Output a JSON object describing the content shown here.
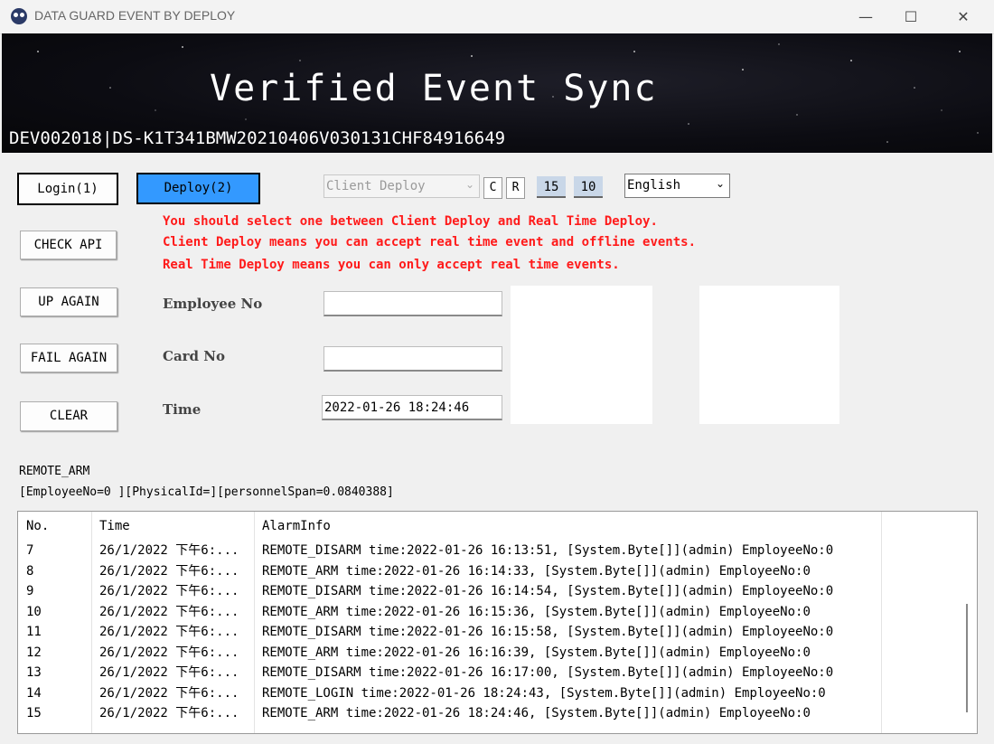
{
  "window": {
    "title": "DATA GUARD EVENT BY DEPLOY",
    "minimize": "—",
    "maximize": "☐",
    "close": "✕"
  },
  "banner": {
    "title": "Verified Event Sync",
    "device": "DEV002018|DS-K1T341BMW20210406V030131CHF84916649"
  },
  "buttons": {
    "login": "Login(1)",
    "deploy": "Deploy(2)",
    "check_api": "CHECK API",
    "up_again": "UP AGAIN",
    "fail_again": "FAIL AGAIN",
    "clear": "CLEAR"
  },
  "deploy_mode": {
    "selected": "Client Deploy"
  },
  "small_buttons": {
    "c": "C",
    "r": "R"
  },
  "numbers": {
    "first": "15",
    "second": "10"
  },
  "language": {
    "selected": "English"
  },
  "instructions": [
    "You should select one between Client Deploy and Real Time Deploy.",
    "Client Deploy means you can accept real time event and offline events.",
    "Real Time Deploy means you can only accept real time events."
  ],
  "form": {
    "employee_label": "Employee No",
    "employee_value": "",
    "card_label": "Card No",
    "card_value": "",
    "time_label": "Time",
    "time_value": "2022-01-26 18:24:46"
  },
  "status": {
    "line1": "REMOTE_ARM",
    "line2": "[EmployeeNo=0 ][PhysicalId=][personnelSpan=0.0840388]"
  },
  "table": {
    "headers": [
      "No.",
      "Time",
      "AlarmInfo"
    ],
    "rows": [
      [
        "7",
        "26/1/2022 下午6:...",
        "REMOTE_DISARM time:2022-01-26 16:13:51, [System.Byte[]](admin) EmployeeNo:0"
      ],
      [
        "8",
        "26/1/2022 下午6:...",
        "REMOTE_ARM time:2022-01-26 16:14:33, [System.Byte[]](admin) EmployeeNo:0"
      ],
      [
        "9",
        "26/1/2022 下午6:...",
        "REMOTE_DISARM time:2022-01-26 16:14:54, [System.Byte[]](admin) EmployeeNo:0"
      ],
      [
        "10",
        "26/1/2022 下午6:...",
        "REMOTE_ARM time:2022-01-26 16:15:36, [System.Byte[]](admin) EmployeeNo:0"
      ],
      [
        "11",
        "26/1/2022 下午6:...",
        "REMOTE_DISARM time:2022-01-26 16:15:58, [System.Byte[]](admin) EmployeeNo:0"
      ],
      [
        "12",
        "26/1/2022 下午6:...",
        "REMOTE_ARM time:2022-01-26 16:16:39, [System.Byte[]](admin) EmployeeNo:0"
      ],
      [
        "13",
        "26/1/2022 下午6:...",
        "REMOTE_DISARM time:2022-01-26 16:17:00, [System.Byte[]](admin) EmployeeNo:0"
      ],
      [
        "14",
        "26/1/2022 下午6:...",
        "REMOTE_LOGIN time:2022-01-26 18:24:43, [System.Byte[]](admin) EmployeeNo:0"
      ],
      [
        "15",
        "26/1/2022 下午6:...",
        "REMOTE_ARM time:2022-01-26 18:24:46, [System.Byte[]](admin) EmployeeNo:0"
      ]
    ]
  }
}
